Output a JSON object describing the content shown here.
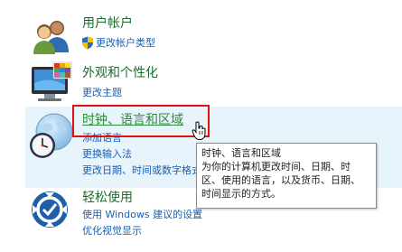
{
  "user_accounts": {
    "title": "用户帐户",
    "links": [
      "更改帐户类型"
    ]
  },
  "appearance": {
    "title": "外观和个性化",
    "links": [
      "更改主题"
    ]
  },
  "clock_region": {
    "title": "时钟、语言和区域",
    "links": [
      "添加语言",
      "更换输入法",
      "更改日期、时间或数字格式"
    ]
  },
  "ease_of_access": {
    "title": "轻松使用",
    "links": [
      "使用 Windows 建议的设置",
      "优化视觉显示"
    ]
  },
  "tooltip": {
    "lines": [
      "时钟、语言和区域",
      "为你的计算机更改时间、日期、时",
      "区、使用的语言，以及货币、日期、",
      "时间显示的方式。"
    ]
  },
  "colors": {
    "title_green": "#1e6b2e",
    "link_blue": "#1a5fb4",
    "highlight_red": "#e01010",
    "hover_band": "#e8f4fc"
  },
  "icons": [
    "users-icon",
    "shield-icon",
    "monitor-palette-icon",
    "globe-clock-icon",
    "ease-of-access-icon",
    "hand-cursor-icon"
  ]
}
